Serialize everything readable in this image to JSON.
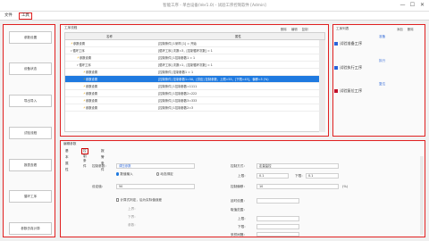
{
  "window": {
    "title": "智能工序 - 单台设备(Ver1.0) - 试验工序控制软件 [Admin]",
    "min": "—",
    "max": "☐",
    "close": "✕"
  },
  "menu": {
    "items": [
      "文件",
      "工具"
    ]
  },
  "left_buttons": [
    "参数设置",
    "设备状态",
    "导出导入",
    "试验流程",
    "报表查看",
    "循环工序",
    "参数仿真计算"
  ],
  "flow": {
    "title": "工序流程",
    "toolbar": [
      "删除",
      "编辑",
      "复制"
    ],
    "columns": [
      "名称",
      "属性"
    ],
    "rows": [
      {
        "indent": 0,
        "toggle": "",
        "icon": true,
        "name": "参数设置",
        "value": "[控制条件] 1采样 [1] = 开始"
      },
      {
        "indent": 0,
        "toggle": "▾",
        "icon": false,
        "name": "循环工序",
        "value": "[循环工序] 次数=3，[控制循环次数] = 1"
      },
      {
        "indent": 1,
        "toggle": "",
        "icon": true,
        "name": "参数设置",
        "value": "[控制条件] 1控制参数1 = 1"
      },
      {
        "indent": 1,
        "toggle": "▾",
        "icon": false,
        "name": "循环工序",
        "value": "[循环工序] 次数=1，[控制循环次数] = 1"
      },
      {
        "indent": 2,
        "toggle": "",
        "icon": true,
        "name": "参数设置",
        "value": "[控制条件] 控制参数1 = 1"
      },
      {
        "indent": 2,
        "toggle": "",
        "icon": true,
        "name": "参数设置",
        "value": "[控制条件] 控制参数1=50，[供应] 控制参数，上限=55，[下限=45]，偏移=5 (%)"
      },
      {
        "indent": 2,
        "toggle": "",
        "icon": true,
        "name": "参数设置",
        "value": "[控制条件] 1控制参数=1111"
      },
      {
        "indent": 2,
        "toggle": "",
        "icon": true,
        "name": "参数设置",
        "value": "[控制条件] 1控制参数2=222"
      },
      {
        "indent": 2,
        "toggle": "",
        "icon": true,
        "name": "参数设置",
        "value": "[控制条件] 1控制参数3=333"
      },
      {
        "indent": 2,
        "toggle": "",
        "icon": true,
        "name": "参数设置",
        "value": "[控制条件] 1控制参数2=3"
      }
    ],
    "selected_index": 5
  },
  "right": {
    "title": "工序列表",
    "toolbar": [
      "添加",
      "删除"
    ],
    "groups": [
      {
        "header": "准备",
        "item": "试验准备工序",
        "color": "#2a62d8"
      },
      {
        "header": "执行",
        "item": "试验执行工序",
        "color": "#2a62d8"
      },
      {
        "header": "复位",
        "item": "试验复位工序",
        "color": "#c0102a"
      }
    ]
  },
  "edit": {
    "title": "编辑参数",
    "tabs": [
      "基本属性",
      "控制条件",
      "报警条件"
    ],
    "active_tab": 1,
    "fields": {
      "control_param_label": "控制参数：",
      "control_param_value": "调压参数",
      "mode_a": "数值输入",
      "mode_b": "动态绑定",
      "setpoint_label": "设定值：",
      "setpoint_value": "50",
      "checkbox_label": "计算式判定，后为实际值误差",
      "sub1": "上界：",
      "sub2": "下界：",
      "sub3": "参数：",
      "ctrl_mode_label": "控制方式：",
      "ctrl_mode_value": "定量监控",
      "upper_label": "上限：",
      "upper_value": "0.1",
      "lower_label": "下限：",
      "lower_value": "0.1",
      "offset_label": "控制偏移：",
      "offset_value": "10",
      "offset_unit": "(%)",
      "delay_label": "延时设置：",
      "range_label": "取值范围：",
      "lim_upper": "上限：",
      "lim_lower": "下限：",
      "sample_label": "采样间隔："
    }
  },
  "colors": {
    "accent": "#e02020",
    "selection": "#1f7ae0",
    "link": "#3a6fd8"
  }
}
